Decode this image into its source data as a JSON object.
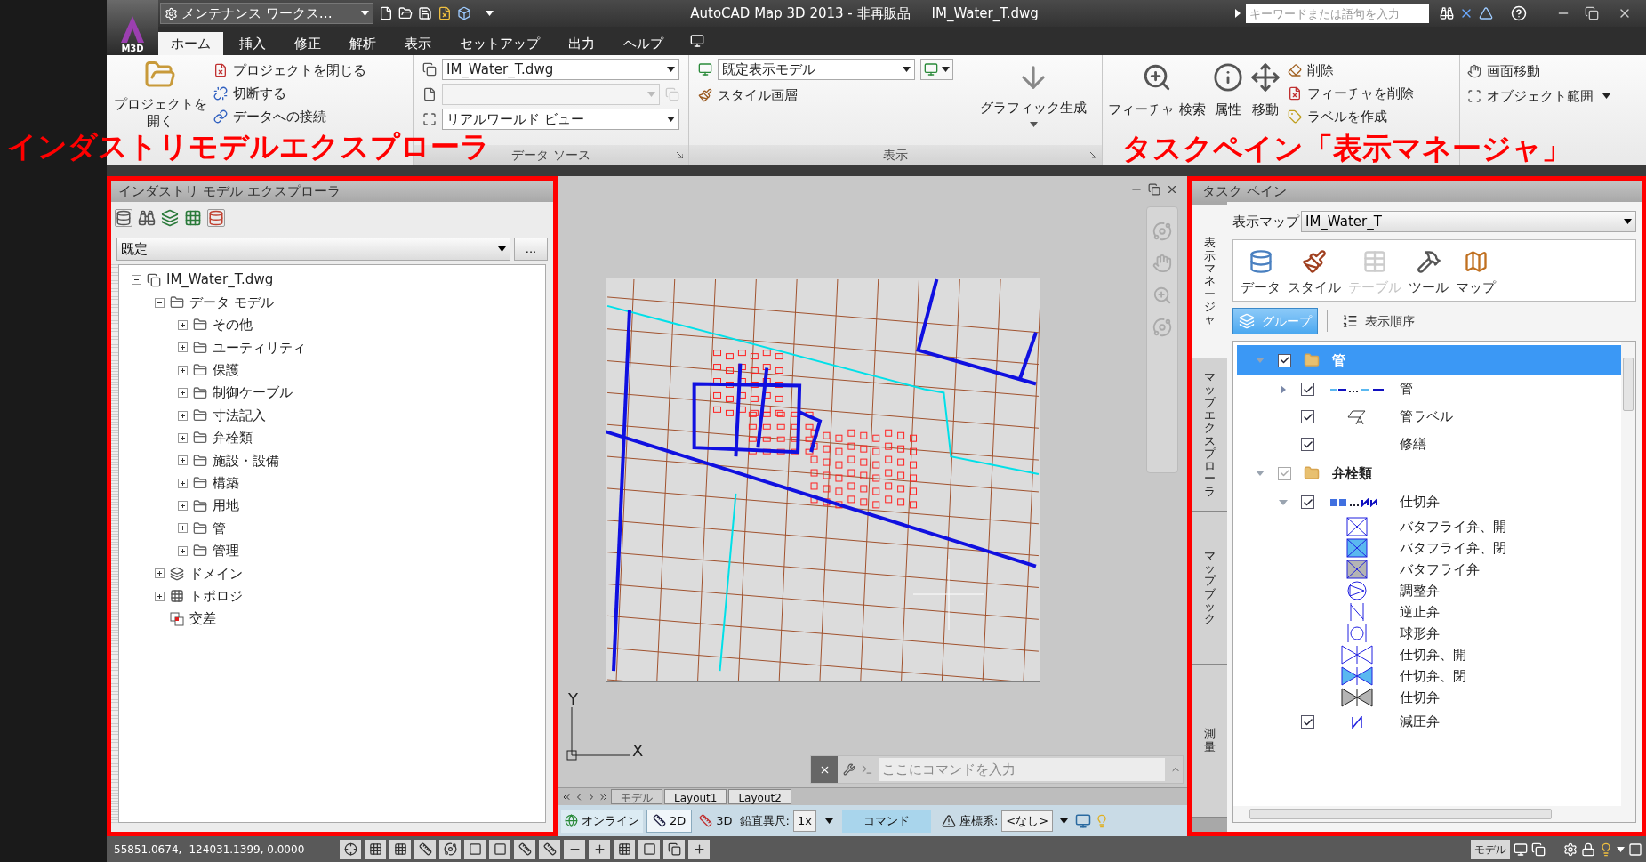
{
  "app_button": {
    "label": "M3D"
  },
  "quick_access": {
    "workspace": "メンテナンス ワークス…"
  },
  "window": {
    "title": "AutoCAD Map 3D 2013 - 非再販品",
    "file": "IM_Water_T.dwg"
  },
  "search": {
    "placeholder": "キーワードまたは語句を入力"
  },
  "ribbon_tabs": [
    {
      "label": "ホーム",
      "selected": true
    },
    {
      "label": "挿入",
      "selected": false
    },
    {
      "label": "修正",
      "selected": false
    },
    {
      "label": "解析",
      "selected": false
    },
    {
      "label": "表示",
      "selected": false
    },
    {
      "label": "セットアップ",
      "selected": false
    },
    {
      "label": "出力",
      "selected": false
    },
    {
      "label": "ヘルプ",
      "selected": false
    }
  ],
  "ribbon": {
    "project_panel": {
      "open": "プロジェクトを開く",
      "actions": [
        "プロジェクトを閉じる",
        "切断する",
        "データへの接続"
      ]
    },
    "data_source_panel": {
      "title": "データ ソース",
      "source": "IM_Water_T.dwg",
      "view": "リアルワールド ビュー"
    },
    "display_panel": {
      "title": "表示",
      "display_model": "既定表示モデル",
      "style": "スタイル画層",
      "generate": "グラフィック生成"
    },
    "edit_panel": {
      "large": [
        "フィーチャ 検索",
        "属性",
        "移動"
      ],
      "small": [
        "削除",
        "フィーチャを削除",
        "ラベルを作成"
      ]
    },
    "view_panel": {
      "actions": [
        "画面移動",
        "オブジェクト範囲"
      ]
    }
  },
  "annotations": [
    {
      "text": "インダストリモデルエクスプローラ"
    },
    {
      "text": "タスクペイン「表示マネージャ」"
    }
  ],
  "explorer": {
    "title": "インダストリ モデル エクスプローラ",
    "filter": "既定",
    "more": "...",
    "tree": [
      {
        "label": "IM_Water_T.dwg",
        "kind": "drawing",
        "expanded": true,
        "children": [
          {
            "label": "データ モデル",
            "kind": "folder",
            "expanded": true,
            "children": [
              {
                "label": "その他",
                "kind": "folder",
                "expanded": false
              },
              {
                "label": "ユーティリティ",
                "kind": "folder",
                "expanded": false
              },
              {
                "label": "保護",
                "kind": "folder",
                "expanded": false
              },
              {
                "label": "制御ケーブル",
                "kind": "folder",
                "expanded": false
              },
              {
                "label": "寸法記入",
                "kind": "folder",
                "expanded": false
              },
              {
                "label": "弁栓類",
                "kind": "folder",
                "expanded": false
              },
              {
                "label": "施設・設備",
                "kind": "folder",
                "expanded": false
              },
              {
                "label": "構築",
                "kind": "folder",
                "expanded": false
              },
              {
                "label": "用地",
                "kind": "folder",
                "expanded": false
              },
              {
                "label": "管",
                "kind": "folder",
                "expanded": false
              },
              {
                "label": "管理",
                "kind": "folder",
                "expanded": false
              }
            ]
          },
          {
            "label": "ドメイン",
            "kind": "domain",
            "expanded": false
          },
          {
            "label": "トポロジ",
            "kind": "topology",
            "expanded": false
          },
          {
            "label": "交差",
            "kind": "intersection"
          }
        ]
      }
    ]
  },
  "drawing": {
    "ucs": {
      "y": "Y",
      "x": "X"
    },
    "command": {
      "placeholder": "ここにコマンドを入力"
    },
    "layout_tabs": [
      {
        "label": "モデル",
        "selected": true
      },
      {
        "label": "Layout1",
        "selected": false
      },
      {
        "label": "Layout2",
        "selected": false
      }
    ]
  },
  "map_status": {
    "online": "オンライン",
    "mode_2d": "2D",
    "mode_3d": "3D",
    "exaggeration_label": "鉛直異尺:",
    "exaggeration": "1x",
    "command": "コマンド",
    "coord_label": "座標系:",
    "coord": "<なし>"
  },
  "task_pane": {
    "title": "タスク ペイン",
    "tabs": [
      {
        "label": "表示マネージャ",
        "selected": true
      },
      {
        "label": "マップエクスプローラ",
        "selected": false
      },
      {
        "label": "マップブック",
        "selected": false
      },
      {
        "label": "測量",
        "selected": false
      }
    ],
    "map_label": "表示マップ",
    "map": "IM_Water_T",
    "tools": [
      {
        "label": "データ",
        "kind": "data",
        "disabled": false
      },
      {
        "label": "スタイル",
        "kind": "style",
        "disabled": false
      },
      {
        "label": "テーブル",
        "kind": "table",
        "disabled": true
      },
      {
        "label": "ツール",
        "kind": "tools",
        "disabled": false
      },
      {
        "label": "マップ",
        "kind": "map",
        "disabled": false
      }
    ],
    "view_modes": [
      {
        "label": "グループ",
        "kind": "group",
        "selected": true
      },
      {
        "label": "表示順序",
        "kind": "order",
        "selected": false
      }
    ],
    "layers": [
      {
        "label": "管",
        "kind": "group",
        "expanded": true,
        "checked": true,
        "greyed": false,
        "selected": true,
        "children": [
          {
            "label": "管",
            "kind": "line_layer",
            "expanded": false,
            "checked": true,
            "greyed": false,
            "selected": false
          },
          {
            "label": "管ラベル",
            "kind": "label_layer",
            "checked": true,
            "greyed": false,
            "selected": false
          },
          {
            "label": "修繕",
            "kind": "plain_layer",
            "checked": true,
            "greyed": false,
            "selected": false
          }
        ]
      },
      {
        "label": "弁栓類",
        "kind": "group",
        "expanded": true,
        "checked": true,
        "greyed": true,
        "selected": false,
        "children": [
          {
            "label": "仕切弁",
            "kind": "symbols_layer",
            "expanded": true,
            "checked": true,
            "greyed": false,
            "selected": false,
            "children": [
              {
                "label": "バタフライ弁、開",
                "kind": "butterfly",
                "color": "#ffffff",
                "selected": false
              },
              {
                "label": "バタフライ弁、閉",
                "kind": "butterfly",
                "color": "#5ab8f0",
                "selected": false
              },
              {
                "label": "バタフライ弁",
                "kind": "butterfly",
                "color": "#b4b4b4",
                "selected": false
              },
              {
                "label": "調整弁",
                "kind": "regulator",
                "selected": false
              },
              {
                "label": "逆止弁",
                "kind": "check",
                "selected": false
              },
              {
                "label": "球形弁",
                "kind": "globe",
                "selected": false
              },
              {
                "label": "仕切弁、開",
                "kind": "gate",
                "color": "#ffffff",
                "selected": false
              },
              {
                "label": "仕切弁、閉",
                "kind": "gate",
                "color": "#5ab8f0",
                "selected": false
              },
              {
                "label": "仕切弁",
                "kind": "gate",
                "color": "#b4b4b4",
                "selected": false
              }
            ]
          },
          {
            "label": "減圧弁",
            "kind": "reducer_layer",
            "checked": true,
            "greyed": false,
            "selected": false
          }
        ]
      }
    ]
  },
  "status_bar": {
    "coordinates": "55851.0674, -124031.1399, 0.0000",
    "space": "モデル"
  }
}
